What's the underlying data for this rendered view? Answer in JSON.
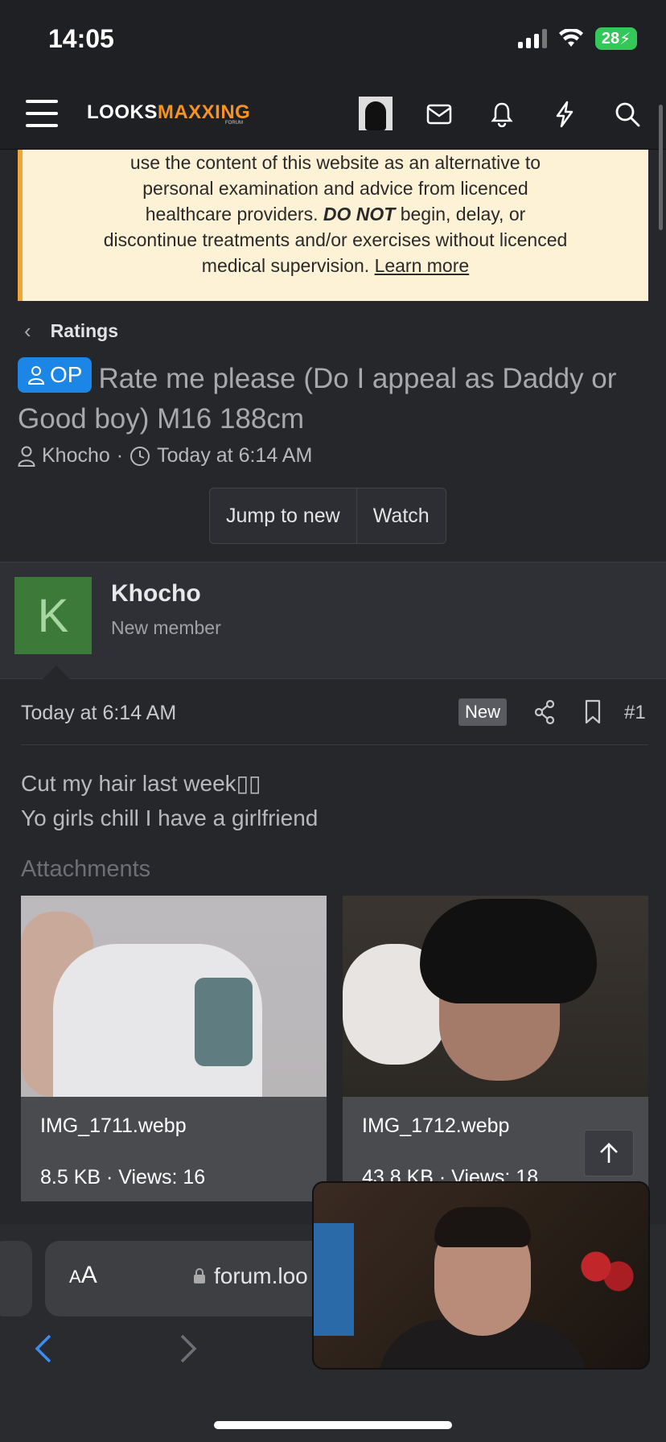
{
  "status_bar": {
    "time": "14:05",
    "battery": "28"
  },
  "header": {
    "logo_main": "LOOKS",
    "logo_accent": "MAXXING",
    "logo_sub": "FORUM"
  },
  "disclaimer": {
    "line1": "use the content of this website as an alternative to",
    "line2": "personal examination and advice from licenced",
    "line3_pre": "healthcare providers.",
    "line3_bold": "DO NOT",
    "line3_post": "begin, delay, or",
    "line4": "discontinue treatments and/or exercises without licenced",
    "line5_pre": "medical supervision.",
    "link": "Learn more"
  },
  "breadcrumb": {
    "label": "Ratings"
  },
  "thread": {
    "op_badge": "OP",
    "title": "Rate me please (Do I appeal as Daddy or Good boy) M16 188cm",
    "author": "Khocho",
    "separator": "·",
    "date": "Today at 6:14 AM",
    "jump_label": "Jump to new",
    "watch_label": "Watch"
  },
  "post": {
    "avatar_letter": "K",
    "username": "Khocho",
    "role": "New member",
    "date": "Today at 6:14 AM",
    "new_badge": "New",
    "number": "#1",
    "body_line1": "Cut my hair last week▯▯",
    "body_line2": "Yo girls chill I have a girlfriend",
    "attachments_heading": "Attachments",
    "attachments": [
      {
        "name": "IMG_1711.webp",
        "info": "8.5 KB · Views: 16"
      },
      {
        "name": "IMG_1712.webp",
        "info": "43.8 KB · Views: 18"
      }
    ]
  },
  "browser": {
    "aa_small": "A",
    "aa_large": "A",
    "url": "forum.loo"
  },
  "colors": {
    "accent": "#f7931e",
    "op_badge": "#1b86e6",
    "disclaimer_bg": "#fdf1d6",
    "avatar_bg": "#3c7a3a"
  }
}
